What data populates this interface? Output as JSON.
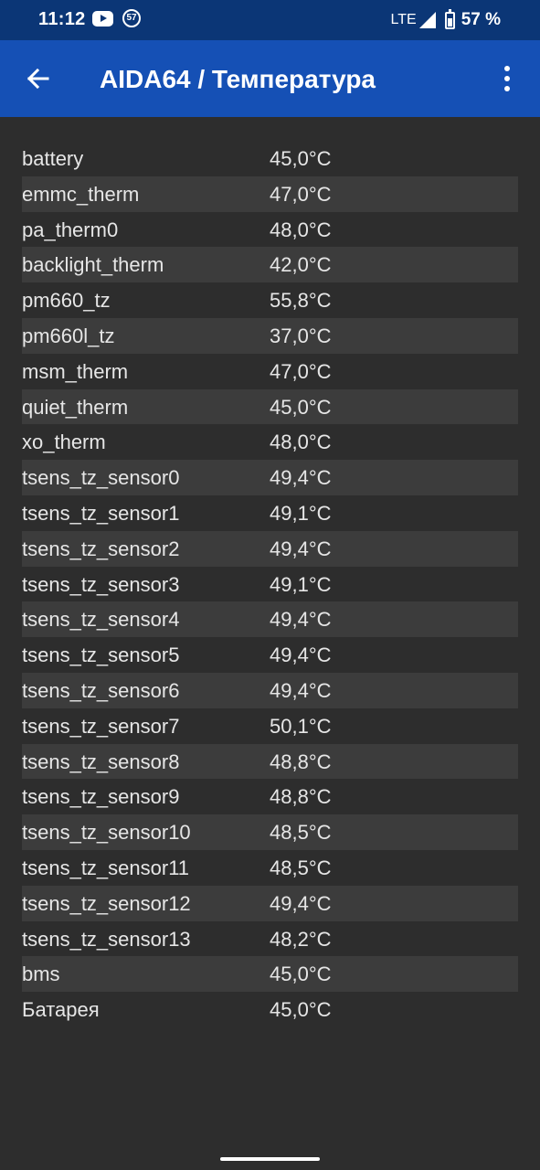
{
  "status_bar": {
    "time": "11:12",
    "youtube_icon": "youtube-icon",
    "notification_badge": "57",
    "network": "LTE",
    "signal_icon": "signal-icon",
    "battery_icon": "battery-charging-icon",
    "battery_percent": "57 %"
  },
  "app_bar": {
    "title": "AIDA64  /  Температура",
    "back_icon": "arrow-left-icon",
    "menu_icon": "more-vert-icon"
  },
  "sensors": [
    {
      "name": "battery",
      "value": "45,0°C"
    },
    {
      "name": "emmc_therm",
      "value": "47,0°C"
    },
    {
      "name": "pa_therm0",
      "value": "48,0°C"
    },
    {
      "name": "backlight_therm",
      "value": "42,0°C"
    },
    {
      "name": "pm660_tz",
      "value": "55,8°C"
    },
    {
      "name": "pm660l_tz",
      "value": "37,0°C"
    },
    {
      "name": "msm_therm",
      "value": "47,0°C"
    },
    {
      "name": "quiet_therm",
      "value": "45,0°C"
    },
    {
      "name": "xo_therm",
      "value": "48,0°C"
    },
    {
      "name": "tsens_tz_sensor0",
      "value": "49,4°C"
    },
    {
      "name": "tsens_tz_sensor1",
      "value": "49,1°C"
    },
    {
      "name": "tsens_tz_sensor2",
      "value": "49,4°C"
    },
    {
      "name": "tsens_tz_sensor3",
      "value": "49,1°C"
    },
    {
      "name": "tsens_tz_sensor4",
      "value": "49,4°C"
    },
    {
      "name": "tsens_tz_sensor5",
      "value": "49,4°C"
    },
    {
      "name": "tsens_tz_sensor6",
      "value": "49,4°C"
    },
    {
      "name": "tsens_tz_sensor7",
      "value": "50,1°C"
    },
    {
      "name": "tsens_tz_sensor8",
      "value": "48,8°C"
    },
    {
      "name": "tsens_tz_sensor9",
      "value": "48,8°C"
    },
    {
      "name": "tsens_tz_sensor10",
      "value": "48,5°C"
    },
    {
      "name": "tsens_tz_sensor11",
      "value": "48,5°C"
    },
    {
      "name": "tsens_tz_sensor12",
      "value": "49,4°C"
    },
    {
      "name": "tsens_tz_sensor13",
      "value": "48,2°C"
    },
    {
      "name": "bms",
      "value": "45,0°C"
    },
    {
      "name": "Батарея",
      "value": "45,0°C"
    }
  ],
  "colors": {
    "status_bar": "#0b3676",
    "app_bar": "#1550b5",
    "background": "#2d2d2d",
    "row_alt": "#3c3c3c",
    "text": "#e6e6e6"
  }
}
